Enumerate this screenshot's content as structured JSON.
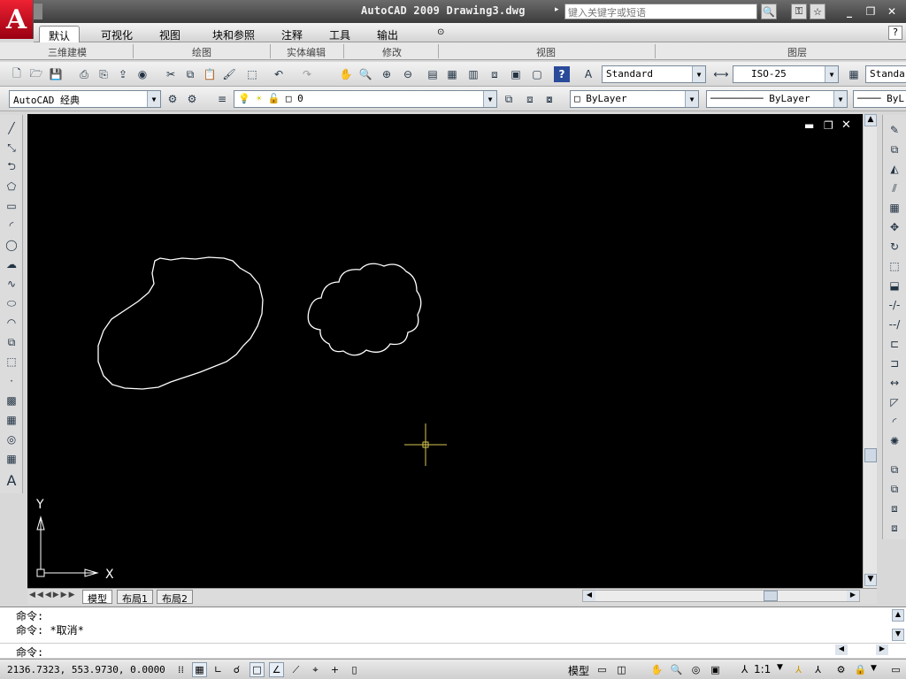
{
  "window": {
    "title": "AutoCAD 2009  Drawing3.dwg",
    "search_placeholder": "键入关键字或短语"
  },
  "ribbon": {
    "tabs": [
      {
        "label": "默认",
        "active": true
      },
      {
        "label": "可视化"
      },
      {
        "label": "视图"
      },
      {
        "label": "块和参照"
      },
      {
        "label": "注释"
      },
      {
        "label": "工具"
      },
      {
        "label": "输出"
      }
    ],
    "panels": [
      "三维建模",
      "绘图",
      "实体编辑",
      "修改",
      "视图",
      "图层"
    ]
  },
  "toolbar1": {
    "text_style": "Standard",
    "dim_style": "ISO-25",
    "table_style": "Standar"
  },
  "toolbar2": {
    "workspace": "AutoCAD 经典",
    "layer": "0",
    "color": "ByLayer",
    "linetype": "ByLayer",
    "lineweight": "ByL"
  },
  "viewport": {
    "background": "#000000",
    "axis_x_label": "X",
    "axis_y_label": "Y",
    "crosshair_color": "#d8c850",
    "drawing_color": "#ffffff"
  },
  "layout_tabs": [
    "模型",
    "布局1",
    "布局2"
  ],
  "command": {
    "lines": [
      "命令:",
      "命令: *取消*"
    ],
    "prompt": "命令:"
  },
  "status": {
    "coordinates": "2136.7323, 553.9730, 0.0000",
    "model_label": "模型",
    "annotation_scale": "1:1"
  }
}
